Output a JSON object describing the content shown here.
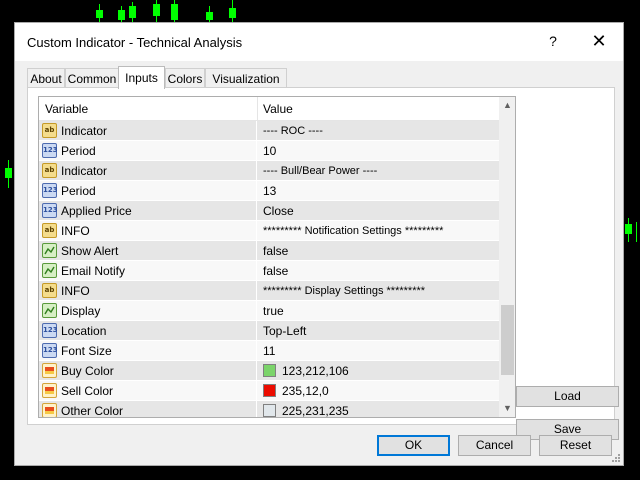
{
  "window": {
    "title": "Custom Indicator - Technical Analysis",
    "help_glyph": "?",
    "close_glyph": "✕"
  },
  "tabs": [
    {
      "label": "About"
    },
    {
      "label": "Common"
    },
    {
      "label": "Inputs"
    },
    {
      "label": "Colors"
    },
    {
      "label": "Visualization"
    }
  ],
  "grid": {
    "col_variable": "Variable",
    "col_value": "Value"
  },
  "rows": [
    {
      "type": "str",
      "name": "Indicator",
      "value": "---- ROC ----"
    },
    {
      "type": "num",
      "name": "Period",
      "value": "10"
    },
    {
      "type": "str",
      "name": "Indicator",
      "value": "---- Bull/Bear Power ----"
    },
    {
      "type": "num",
      "name": "Period",
      "value": "13"
    },
    {
      "type": "num",
      "name": "Applied Price",
      "value": "Close"
    },
    {
      "type": "str",
      "name": "INFO",
      "value": "********* Notification Settings *********"
    },
    {
      "type": "bool",
      "name": "Show Alert",
      "value": "false"
    },
    {
      "type": "bool",
      "name": "Email Notify",
      "value": "false"
    },
    {
      "type": "str",
      "name": "INFO",
      "value": "********* Display Settings *********"
    },
    {
      "type": "bool",
      "name": "Display",
      "value": "true"
    },
    {
      "type": "num",
      "name": "Location",
      "value": "Top-Left"
    },
    {
      "type": "num",
      "name": "Font Size",
      "value": "11"
    },
    {
      "type": "color",
      "name": "Buy Color",
      "value": "123,212,106",
      "swatch": "#7bd46a"
    },
    {
      "type": "color",
      "name": "Sell Color",
      "value": "235,12,0",
      "swatch": "#eb0c00"
    },
    {
      "type": "color",
      "name": "Other Color",
      "value": "225,231,235",
      "swatch": "#e1e7eb"
    }
  ],
  "icons": {
    "num": "123",
    "str": "ab"
  },
  "buttons": {
    "load": "Load",
    "save": "Save",
    "ok": "OK",
    "cancel": "Cancel",
    "reset": "Reset"
  },
  "colors": {
    "accent": "#0078d7",
    "chart_candle": "#00ff00"
  }
}
